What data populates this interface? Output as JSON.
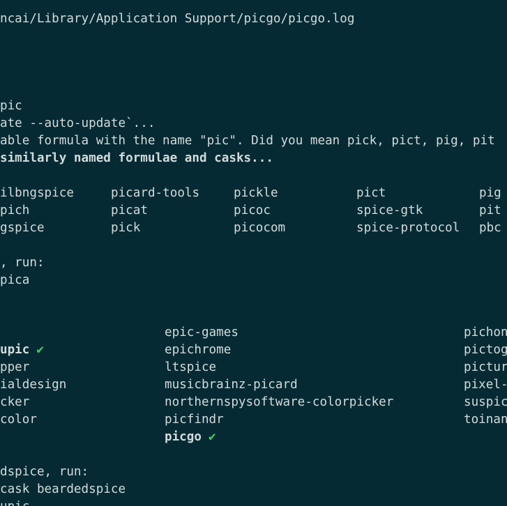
{
  "header": {
    "log_path": "ncai/Library/Application Support/picgo/picgo.log"
  },
  "search": {
    "command_tail": "pic",
    "auto_update": "ate --auto-update`...",
    "no_formula_msg": "able formula with the name \"pic\". Did you mean pick, pict, pig, pit",
    "searching_msg": "similarly named formulae and casks..."
  },
  "formulae": {
    "rows": [
      [
        "ilbngspice",
        "picard-tools",
        "pickle",
        "pict",
        "pig"
      ],
      [
        "pich",
        "picat",
        "picoc",
        "spice-gtk",
        "pit"
      ],
      [
        "gspice",
        "pick",
        "picocom",
        "spice-protocol",
        "pbc"
      ]
    ],
    "install_hint": ", run:",
    "install_cmd": "pica"
  },
  "casks": {
    "col1": [
      "upic",
      "pper",
      "ialdesign",
      "cker",
      "color"
    ],
    "col1_checked": [
      true,
      false,
      false,
      false,
      false
    ],
    "col2": [
      "epic-games",
      "epichrome",
      "ltspice",
      "musicbrainz-picard",
      "northernspysoftware-colorpicker",
      "picfindr",
      "picgo"
    ],
    "col2_checked": [
      false,
      false,
      false,
      false,
      false,
      false,
      true
    ],
    "col3": [
      "pichon",
      "pictogram",
      "picturama",
      "pixel-picker",
      "suspicious-package",
      "toinane"
    ]
  },
  "footer": {
    "hint": "dspice, run:",
    "cmd": "cask beardedspice",
    "partial": "upic"
  },
  "symbols": {
    "check": "✔"
  },
  "colors": {
    "background": "#062a33",
    "text": "#d2dbdc",
    "check": "#3ed36a"
  }
}
